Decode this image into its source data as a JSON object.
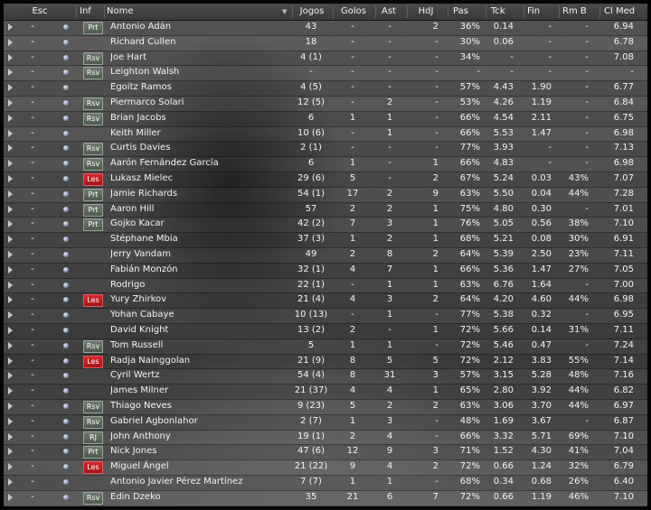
{
  "table": {
    "headers": [
      "Esc",
      "Inf",
      "Nome",
      "Jogos",
      "Golos",
      "Ast",
      "HdJ",
      "Pas",
      "Tck",
      "Fin",
      "Rm B",
      "Cl Med"
    ],
    "sort_column": "Nome",
    "rows": [
      {
        "esc": "-",
        "inf": "Prt",
        "nome": "Antonio Adán",
        "jogos": "43",
        "golos": "-",
        "ast": "-",
        "hdj": "2",
        "pas": "36%",
        "tck": "0.14",
        "fin": "-",
        "rmb": "-",
        "clmed": "6.94"
      },
      {
        "esc": "-",
        "inf": "",
        "nome": "Richard Cullen",
        "jogos": "18",
        "golos": "-",
        "ast": "-",
        "hdj": "-",
        "pas": "30%",
        "tck": "0.06",
        "fin": "-",
        "rmb": "-",
        "clmed": "6.78"
      },
      {
        "esc": "-",
        "inf": "Rsv",
        "nome": "Joe Hart",
        "jogos": "4 (1)",
        "golos": "-",
        "ast": "-",
        "hdj": "-",
        "pas": "34%",
        "tck": "-",
        "fin": "-",
        "rmb": "-",
        "clmed": "7.08"
      },
      {
        "esc": "-",
        "inf": "Rsv",
        "nome": "Leighton Walsh",
        "jogos": "-",
        "golos": "-",
        "ast": "-",
        "hdj": "-",
        "pas": "-",
        "tck": "-",
        "fin": "-",
        "rmb": "-",
        "clmed": "-"
      },
      {
        "esc": "-",
        "inf": "",
        "nome": "Egoitz Ramos",
        "jogos": "4 (5)",
        "golos": "-",
        "ast": "-",
        "hdj": "-",
        "pas": "57%",
        "tck": "4.43",
        "fin": "1.90",
        "rmb": "-",
        "clmed": "6.77"
      },
      {
        "esc": "-",
        "inf": "Rsv",
        "nome": "Piermarco Solari",
        "jogos": "12 (5)",
        "golos": "-",
        "ast": "2",
        "hdj": "-",
        "pas": "53%",
        "tck": "4.26",
        "fin": "1.19",
        "rmb": "-",
        "clmed": "6.84"
      },
      {
        "esc": "-",
        "inf": "Rsv",
        "nome": "Brian Jacobs",
        "jogos": "6",
        "golos": "1",
        "ast": "1",
        "hdj": "-",
        "pas": "66%",
        "tck": "4.54",
        "fin": "2.11",
        "rmb": "-",
        "clmed": "6.75"
      },
      {
        "esc": "-",
        "inf": "",
        "nome": "Keith Miller",
        "jogos": "10 (6)",
        "golos": "-",
        "ast": "1",
        "hdj": "-",
        "pas": "66%",
        "tck": "5.53",
        "fin": "1.47",
        "rmb": "-",
        "clmed": "6.98"
      },
      {
        "esc": "-",
        "inf": "Rsv",
        "nome": "Curtis Davies",
        "jogos": "2 (1)",
        "golos": "-",
        "ast": "-",
        "hdj": "-",
        "pas": "77%",
        "tck": "3.93",
        "fin": "-",
        "rmb": "-",
        "clmed": "7.13"
      },
      {
        "esc": "-",
        "inf": "Rsv",
        "nome": "Aarón Fernández García",
        "jogos": "6",
        "golos": "1",
        "ast": "-",
        "hdj": "1",
        "pas": "66%",
        "tck": "4.83",
        "fin": "-",
        "rmb": "-",
        "clmed": "6.98"
      },
      {
        "esc": "-",
        "inf": "Les",
        "nome": "Lukasz Mielec",
        "jogos": "29 (6)",
        "golos": "5",
        "ast": "-",
        "hdj": "2",
        "pas": "67%",
        "tck": "5.24",
        "fin": "0.03",
        "rmb": "43%",
        "clmed": "7.07"
      },
      {
        "esc": "-",
        "inf": "Prt",
        "nome": "Jamie Richards",
        "jogos": "54 (1)",
        "golos": "17",
        "ast": "2",
        "hdj": "9",
        "pas": "63%",
        "tck": "5.50",
        "fin": "0.04",
        "rmb": "44%",
        "clmed": "7.28"
      },
      {
        "esc": "-",
        "inf": "Prt",
        "nome": "Aaron Hill",
        "jogos": "57",
        "golos": "2",
        "ast": "2",
        "hdj": "1",
        "pas": "75%",
        "tck": "4.80",
        "fin": "0.30",
        "rmb": "-",
        "clmed": "7.01"
      },
      {
        "esc": "-",
        "inf": "Prt",
        "nome": "Gojko Kacar",
        "jogos": "42 (2)",
        "golos": "7",
        "ast": "3",
        "hdj": "1",
        "pas": "76%",
        "tck": "5.05",
        "fin": "0.56",
        "rmb": "38%",
        "clmed": "7.10"
      },
      {
        "esc": "-",
        "inf": "",
        "nome": "Stéphane Mbia",
        "jogos": "37 (3)",
        "golos": "1",
        "ast": "2",
        "hdj": "1",
        "pas": "68%",
        "tck": "5.21",
        "fin": "0.08",
        "rmb": "30%",
        "clmed": "6.91"
      },
      {
        "esc": "-",
        "inf": "",
        "nome": "Jerry Vandam",
        "jogos": "49",
        "golos": "2",
        "ast": "8",
        "hdj": "2",
        "pas": "64%",
        "tck": "5.39",
        "fin": "2.50",
        "rmb": "23%",
        "clmed": "7.11"
      },
      {
        "esc": "-",
        "inf": "",
        "nome": "Fabián Monzón",
        "jogos": "32 (1)",
        "golos": "4",
        "ast": "7",
        "hdj": "1",
        "pas": "66%",
        "tck": "5.36",
        "fin": "1.47",
        "rmb": "27%",
        "clmed": "7.05"
      },
      {
        "esc": "-",
        "inf": "",
        "nome": "Rodrigo",
        "jogos": "22 (1)",
        "golos": "-",
        "ast": "1",
        "hdj": "1",
        "pas": "63%",
        "tck": "6.76",
        "fin": "1.64",
        "rmb": "-",
        "clmed": "7.00"
      },
      {
        "esc": "-",
        "inf": "Les",
        "nome": "Yury Zhirkov",
        "jogos": "21 (4)",
        "golos": "4",
        "ast": "3",
        "hdj": "2",
        "pas": "64%",
        "tck": "4.20",
        "fin": "4.60",
        "rmb": "44%",
        "clmed": "6.98"
      },
      {
        "esc": "-",
        "inf": "",
        "nome": "Yohan Cabaye",
        "jogos": "10 (13)",
        "golos": "-",
        "ast": "1",
        "hdj": "-",
        "pas": "77%",
        "tck": "5.38",
        "fin": "0.32",
        "rmb": "-",
        "clmed": "6.95"
      },
      {
        "esc": "-",
        "inf": "",
        "nome": "David Knight",
        "jogos": "13 (2)",
        "golos": "2",
        "ast": "-",
        "hdj": "1",
        "pas": "72%",
        "tck": "5.66",
        "fin": "0.14",
        "rmb": "31%",
        "clmed": "7.11"
      },
      {
        "esc": "-",
        "inf": "Rsv",
        "nome": "Tom Russell",
        "jogos": "5",
        "golos": "1",
        "ast": "1",
        "hdj": "-",
        "pas": "72%",
        "tck": "5.46",
        "fin": "0.47",
        "rmb": "-",
        "clmed": "7.24"
      },
      {
        "esc": "-",
        "inf": "Les",
        "nome": "Radja Nainggolan",
        "jogos": "21 (9)",
        "golos": "8",
        "ast": "5",
        "hdj": "5",
        "pas": "72%",
        "tck": "2.12",
        "fin": "3.83",
        "rmb": "55%",
        "clmed": "7.14"
      },
      {
        "esc": "-",
        "inf": "",
        "nome": "Cyril Wertz",
        "jogos": "54 (4)",
        "golos": "8",
        "ast": "31",
        "hdj": "3",
        "pas": "57%",
        "tck": "3.15",
        "fin": "5.28",
        "rmb": "48%",
        "clmed": "7.16"
      },
      {
        "esc": "-",
        "inf": "",
        "nome": "James Milner",
        "jogos": "21 (37)",
        "golos": "4",
        "ast": "4",
        "hdj": "1",
        "pas": "65%",
        "tck": "2.80",
        "fin": "3.92",
        "rmb": "44%",
        "clmed": "6.82"
      },
      {
        "esc": "-",
        "inf": "Rsv",
        "nome": "Thiago Neves",
        "jogos": "9 (23)",
        "golos": "5",
        "ast": "2",
        "hdj": "2",
        "pas": "63%",
        "tck": "3.06",
        "fin": "3.70",
        "rmb": "44%",
        "clmed": "6.97"
      },
      {
        "esc": "-",
        "inf": "Rsv",
        "nome": "Gabriel Agbonlahor",
        "jogos": "2 (7)",
        "golos": "1",
        "ast": "3",
        "hdj": "-",
        "pas": "48%",
        "tck": "1.69",
        "fin": "3.67",
        "rmb": "-",
        "clmed": "6.87"
      },
      {
        "esc": "-",
        "inf": "RJ",
        "nome": "John Anthony",
        "jogos": "19 (1)",
        "golos": "2",
        "ast": "4",
        "hdj": "-",
        "pas": "66%",
        "tck": "3.32",
        "fin": "5.71",
        "rmb": "69%",
        "clmed": "7.10"
      },
      {
        "esc": "-",
        "inf": "Prt",
        "nome": "Nick Jones",
        "jogos": "47 (6)",
        "golos": "12",
        "ast": "9",
        "hdj": "3",
        "pas": "71%",
        "tck": "1.52",
        "fin": "4.30",
        "rmb": "41%",
        "clmed": "7.04"
      },
      {
        "esc": "-",
        "inf": "Les",
        "nome": "Miguel Ángel",
        "jogos": "21 (22)",
        "golos": "9",
        "ast": "4",
        "hdj": "2",
        "pas": "72%",
        "tck": "0.66",
        "fin": "1.24",
        "rmb": "32%",
        "clmed": "6.79"
      },
      {
        "esc": "-",
        "inf": "",
        "nome": "Antonio Javier Pérez Martínez",
        "jogos": "7 (7)",
        "golos": "1",
        "ast": "1",
        "hdj": "-",
        "pas": "68%",
        "tck": "0.34",
        "fin": "0.68",
        "rmb": "26%",
        "clmed": "6.40"
      },
      {
        "esc": "-",
        "inf": "Rsv",
        "nome": "Edin Dzeko",
        "jogos": "35",
        "golos": "21",
        "ast": "6",
        "hdj": "7",
        "pas": "72%",
        "tck": "0.66",
        "fin": "1.19",
        "rmb": "46%",
        "clmed": "7.10"
      }
    ]
  },
  "icons": {
    "expander": "play-triangle-icon",
    "status_dot": "status-dot-icon",
    "sort": "sort-arrow-icon"
  },
  "colors": {
    "injury_badge": "#c81e24",
    "neutral_badge": "#5e6a5e",
    "header_bg": "#3f3f3f",
    "text": "#f4f4f4"
  }
}
